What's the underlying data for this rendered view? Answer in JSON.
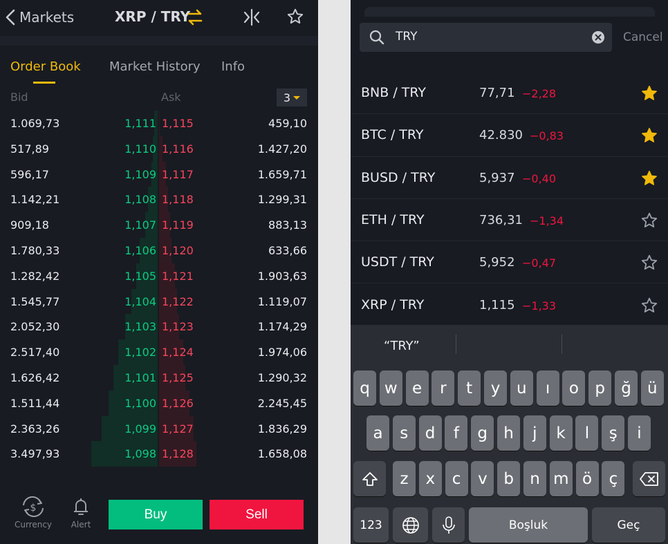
{
  "left": {
    "header": {
      "back_label": "Markets",
      "pair": "XRP / TRY"
    },
    "tabs": [
      {
        "label": "Order Book"
      },
      {
        "label": "Market History"
      },
      {
        "label": "Info"
      }
    ],
    "orderbook": {
      "bid_label": "Bid",
      "ask_label": "Ask",
      "depth": "3",
      "rows": [
        {
          "bid_qty": "1.069,73",
          "bid_price": "1,111",
          "ask_price": "1,115",
          "ask_qty": "459,10"
        },
        {
          "bid_qty": "517,89",
          "bid_price": "1,110",
          "ask_price": "1,116",
          "ask_qty": "1.427,20"
        },
        {
          "bid_qty": "596,17",
          "bid_price": "1,109",
          "ask_price": "1,117",
          "ask_qty": "1.659,71"
        },
        {
          "bid_qty": "1.142,21",
          "bid_price": "1,108",
          "ask_price": "1,118",
          "ask_qty": "1.299,31"
        },
        {
          "bid_qty": "909,18",
          "bid_price": "1,107",
          "ask_price": "1,119",
          "ask_qty": "883,13"
        },
        {
          "bid_qty": "1.780,33",
          "bid_price": "1,106",
          "ask_price": "1,120",
          "ask_qty": "633,66"
        },
        {
          "bid_qty": "1.282,42",
          "bid_price": "1,105",
          "ask_price": "1,121",
          "ask_qty": "1.903,63"
        },
        {
          "bid_qty": "1.545,77",
          "bid_price": "1,104",
          "ask_price": "1,122",
          "ask_qty": "1.119,07"
        },
        {
          "bid_qty": "2.052,30",
          "bid_price": "1,103",
          "ask_price": "1,123",
          "ask_qty": "1.174,29"
        },
        {
          "bid_qty": "2.517,40",
          "bid_price": "1,102",
          "ask_price": "1,124",
          "ask_qty": "1.974,06"
        },
        {
          "bid_qty": "1.626,42",
          "bid_price": "1,101",
          "ask_price": "1,125",
          "ask_qty": "1.290,32"
        },
        {
          "bid_qty": "1.511,44",
          "bid_price": "1,100",
          "ask_price": "1,126",
          "ask_qty": "2.245,45"
        },
        {
          "bid_qty": "2.363,26",
          "bid_price": "1,099",
          "ask_price": "1,127",
          "ask_qty": "1.836,29"
        },
        {
          "bid_qty": "3.497,93",
          "bid_price": "1,098",
          "ask_price": "1,128",
          "ask_qty": "1.658,08"
        }
      ]
    },
    "bottom": {
      "currency_label": "Currency",
      "alert_label": "Alert",
      "buy_label": "Buy",
      "sell_label": "Sell"
    }
  },
  "right": {
    "search": {
      "query": "TRY",
      "cancel_label": "Cancel"
    },
    "results": [
      {
        "symbol": "BNB / TRY",
        "price": "77,71",
        "change": "−2,28",
        "favorite": true
      },
      {
        "symbol": "BTC / TRY",
        "price": "42.830",
        "change": "−0,83",
        "favorite": true
      },
      {
        "symbol": "BUSD / TRY",
        "price": "5,937",
        "change": "−0,40",
        "favorite": true
      },
      {
        "symbol": "ETH / TRY",
        "price": "736,31",
        "change": "−1,34",
        "favorite": false
      },
      {
        "symbol": "USDT / TRY",
        "price": "5,952",
        "change": "−0,47",
        "favorite": false
      },
      {
        "symbol": "XRP / TRY",
        "price": "1,115",
        "change": "−1,33",
        "favorite": false
      }
    ],
    "keyboard": {
      "suggestion": "“TRY”",
      "row1": [
        "q",
        "w",
        "e",
        "r",
        "t",
        "y",
        "u",
        "ı",
        "o",
        "p",
        "ğ",
        "ü"
      ],
      "row2": [
        "a",
        "s",
        "d",
        "f",
        "g",
        "h",
        "j",
        "k",
        "l",
        "ş",
        "i"
      ],
      "row3": [
        "z",
        "x",
        "c",
        "v",
        "b",
        "n",
        "m",
        "ö",
        "ç"
      ],
      "numbers_label": "123",
      "space_label": "Boşluk",
      "return_label": "Geç"
    }
  },
  "colors": {
    "accent": "#f0b90b",
    "bid_green": "#0ecb81",
    "ask_red": "#f6465d",
    "buy": "#03bd7e",
    "sell": "#f0153f"
  }
}
